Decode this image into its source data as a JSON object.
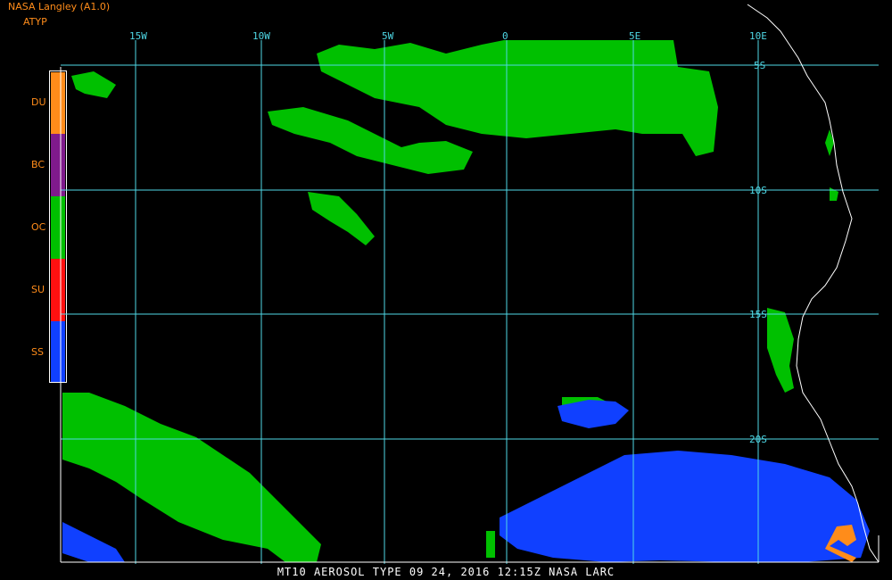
{
  "header": {
    "title": "NASA Langley (A1.0)",
    "product": "ATYP"
  },
  "legend": [
    {
      "code": "DU",
      "color": "#ff8c1a"
    },
    {
      "code": "BC",
      "color": "#7f1a8c"
    },
    {
      "code": "OC",
      "color": "#00c000"
    },
    {
      "code": "SU",
      "color": "#ff1010"
    },
    {
      "code": "SS",
      "color": "#1040ff"
    }
  ],
  "longitude_labels": [
    "15W",
    "10W",
    "5W",
    "0",
    "5E",
    "10E"
  ],
  "latitude_labels": [
    "5S",
    "10S",
    "15S",
    "20S"
  ],
  "colors": {
    "grid": "#4fd8e6",
    "coast": "#ffffff",
    "background": "#000000"
  },
  "footer": "MT10  AEROSOL TYPE  09 24, 2016 12:15Z  NASA LARC"
}
